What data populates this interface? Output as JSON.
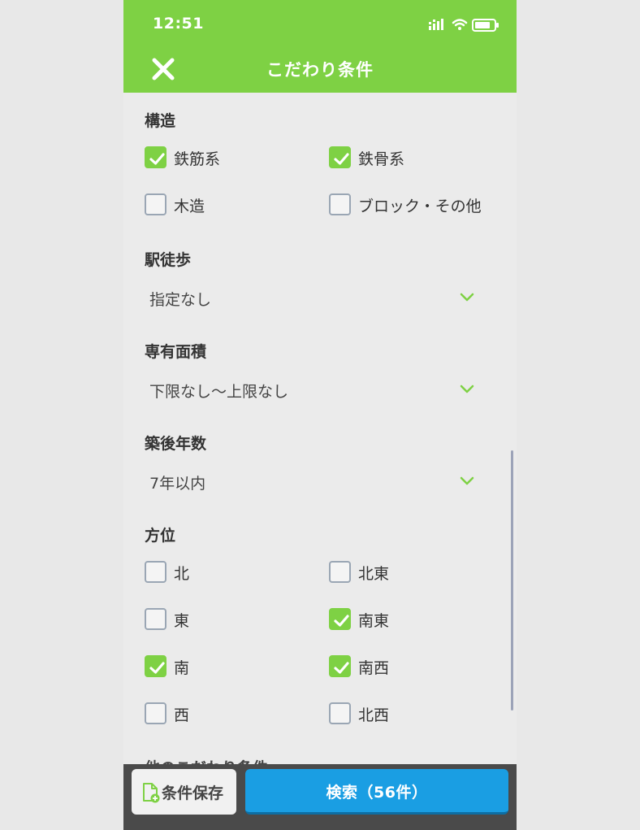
{
  "status_bar": {
    "time": "12:51"
  },
  "header": {
    "title": "こだわり条件"
  },
  "sections": {
    "structure": {
      "title": "構造",
      "options": [
        {
          "label": "鉄筋系",
          "checked": true
        },
        {
          "label": "鉄骨系",
          "checked": true
        },
        {
          "label": "木造",
          "checked": false
        },
        {
          "label": "ブロック・その他",
          "checked": false
        }
      ]
    },
    "walk": {
      "title": "駅徒歩",
      "value": "指定なし"
    },
    "area": {
      "title": "専有面積",
      "value": "下限なし～上限なし"
    },
    "age": {
      "title": "築後年数",
      "value": "7年以内"
    },
    "direction": {
      "title": "方位",
      "options": [
        {
          "label": "北",
          "checked": false
        },
        {
          "label": "北東",
          "checked": false
        },
        {
          "label": "東",
          "checked": false
        },
        {
          "label": "南東",
          "checked": true
        },
        {
          "label": "南",
          "checked": true
        },
        {
          "label": "南西",
          "checked": true
        },
        {
          "label": "西",
          "checked": false
        },
        {
          "label": "北西",
          "checked": false
        }
      ]
    },
    "other": {
      "title": "他のこだわり条件"
    }
  },
  "footer": {
    "save_label": "条件保存",
    "search_label": "検索（56件）"
  },
  "colors": {
    "accent": "#7ed144",
    "button_blue": "#1a9ee3"
  }
}
